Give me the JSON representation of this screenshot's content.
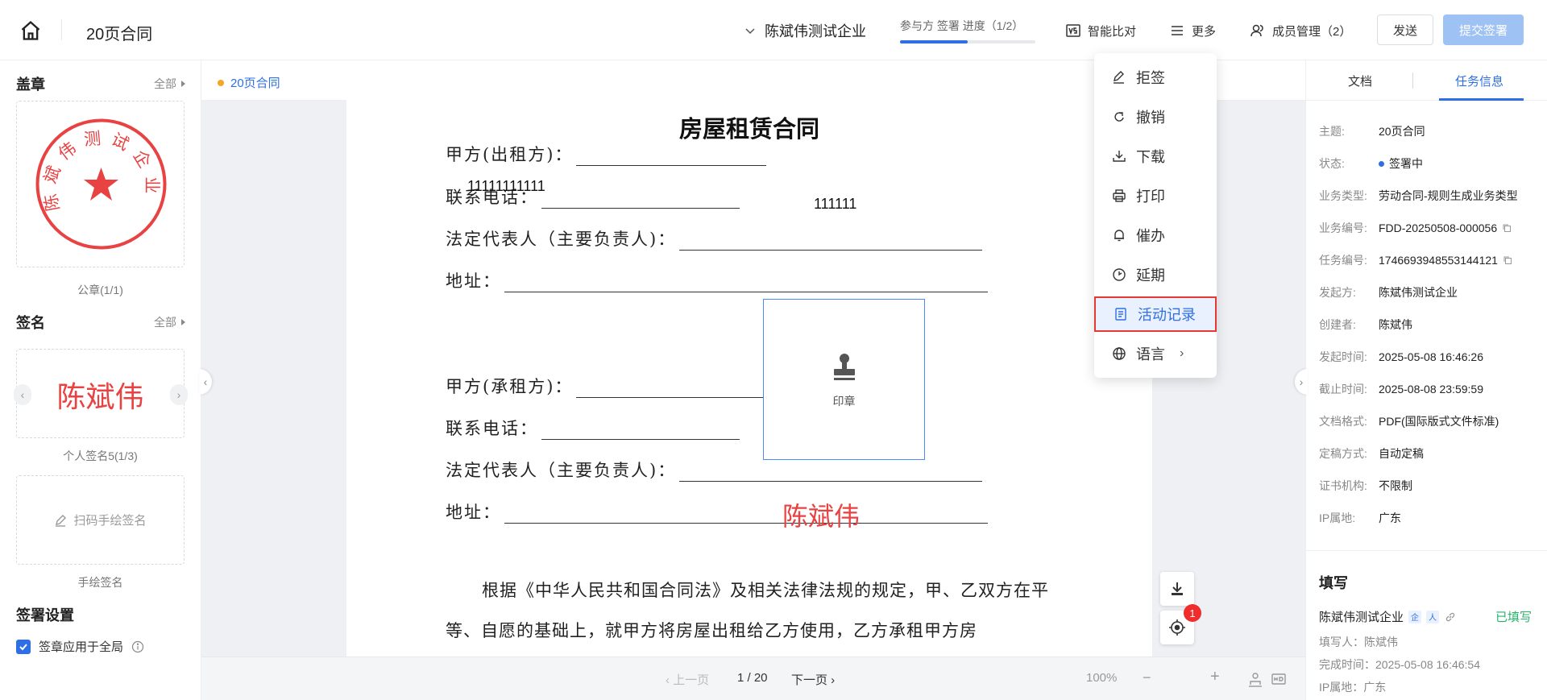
{
  "header": {
    "doc_title": "20页合同",
    "company": "陈斌伟测试企业",
    "progress_text": "参与方 签署 进度（1/2）",
    "progress_value": 0.5,
    "smart_compare": "智能比对",
    "more": "更多",
    "members": "成员管理（2）",
    "send": "发送",
    "submit": "提交签署"
  },
  "left": {
    "seal_title": "盖章",
    "all_label": "全部",
    "seal_text": "陈斌伟测试企业",
    "seal_caption": "公章(1/1)",
    "sign_title": "签名",
    "sign_all_label": "全部",
    "signature_text": "陈斌伟",
    "signature_caption": "个人签名5(1/3)",
    "handwrite_text": "扫码手绘签名",
    "handwrite_caption": "手绘签名",
    "settings_title": "签署设置",
    "apply_global": "签章应用于全局"
  },
  "doc": {
    "tab": "20页合同",
    "heading": "房屋租赁合同",
    "lines": [
      {
        "label": "甲方(出租方)："
      },
      {
        "label": "联系电话："
      },
      {
        "label": "法定代表人（主要负责人)："
      },
      {
        "label": "地址："
      },
      {
        "label": "甲方(承租方)："
      },
      {
        "label": "联系电话："
      },
      {
        "label": "法定代表人（主要负责人)："
      },
      {
        "label": "地址："
      }
    ],
    "overlay_num_1": "11111111111",
    "overlay_num_2": "111111",
    "stamp_label": "印章",
    "sig_on_doc": "陈斌伟",
    "paragraph": "根据《中华人民共和国合同法》及相关法律法规的规定，甲、乙双方在平等、自愿的基础上，就甲方将房屋出租给乙方使用，乙方承租甲方房",
    "badge": "1"
  },
  "pager": {
    "prev": "上一页",
    "page": "1 / 20",
    "next": "下一页",
    "zoom_out": "−",
    "zoom": "100%",
    "zoom_in": "+"
  },
  "menu": {
    "items": [
      {
        "label": "拒签",
        "icon": "edit-icon"
      },
      {
        "label": "撤销",
        "icon": "undo-icon"
      },
      {
        "label": "下载",
        "icon": "download-icon"
      },
      {
        "label": "打印",
        "icon": "printer-icon"
      },
      {
        "label": "催办",
        "icon": "bell-icon"
      },
      {
        "label": "延期",
        "icon": "clock-icon"
      },
      {
        "label": "活动记录",
        "icon": "document-icon"
      },
      {
        "label": "语言",
        "icon": "globe-icon"
      }
    ]
  },
  "right": {
    "tab_doc": "文档",
    "tab_task": "任务信息",
    "info": [
      {
        "k": "主题:",
        "v": "20页合同"
      },
      {
        "k": "状态:",
        "v": "签署中"
      },
      {
        "k": "业务类型:",
        "v": "劳动合同-规则生成业务类型"
      },
      {
        "k": "业务编号:",
        "v": "FDD-20250508-000056"
      },
      {
        "k": "任务编号:",
        "v": "1746693948553144121"
      },
      {
        "k": "发起方:",
        "v": "陈斌伟测试企业"
      },
      {
        "k": "创建者:",
        "v": "陈斌伟"
      },
      {
        "k": "发起时间:",
        "v": "2025-05-08 16:46:26"
      },
      {
        "k": "截止时间:",
        "v": "2025-08-08 23:59:59"
      },
      {
        "k": "文档格式:",
        "v": "PDF(国际版式文件标准)"
      },
      {
        "k": "定稿方式:",
        "v": "自动定稿"
      },
      {
        "k": "证书机构:",
        "v": "不限制"
      },
      {
        "k": "IP属地:",
        "v": "广东"
      }
    ],
    "fill_title": "填写",
    "fill_company": "陈斌伟测试企业",
    "filled": "已填写",
    "filler": "填写人：陈斌伟",
    "finish_time": "完成时间：2025-05-08 16:46:54",
    "ip": "IP属地：广东"
  },
  "colors": {
    "accent": "#2f6fe4",
    "signature_red": "#e84242",
    "filled_green": "#27b36a"
  }
}
